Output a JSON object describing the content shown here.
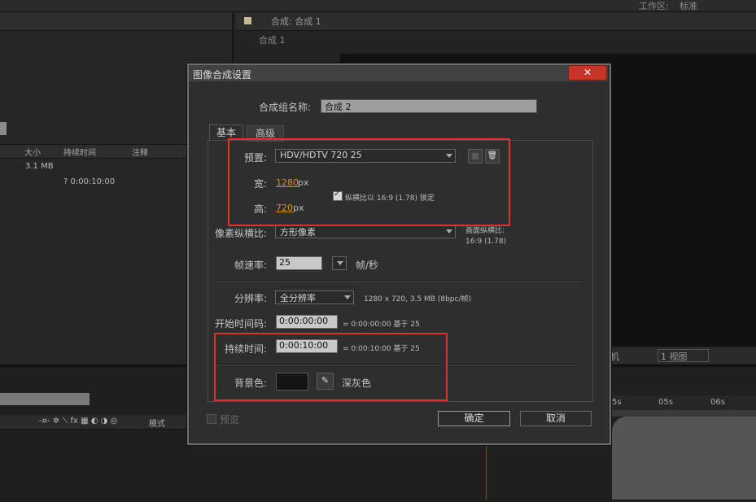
{
  "workspace": {
    "label": "工作区:",
    "value": "标准"
  },
  "project_panel": {
    "columns": [
      "大小",
      "持续时间",
      "注释"
    ],
    "rows": [
      {
        "size": "3.1 MB",
        "duration": ""
      },
      {
        "size": "",
        "duration": "? 0:00:10:00"
      }
    ]
  },
  "composition_panel": {
    "tab_label": "合成: 合成 1",
    "breadcrumb": "合成 1"
  },
  "viewer_toolbar": {
    "camera_suffix": "机",
    "view_select": "1 视图"
  },
  "timeline": {
    "ticks": [
      "5s",
      "05s",
      "06s"
    ],
    "mode_label": "模式"
  },
  "dialog": {
    "title": "图像合成设置",
    "close_label": "✕",
    "name_label": "合成组名称:",
    "name_value": "合成 2",
    "tabs": [
      "基本",
      "高级"
    ],
    "preset_label": "预置:",
    "preset_value": "HDV/HDTV 720 25",
    "width_label": "宽:",
    "width_value": "1280",
    "width_unit": "px",
    "height_label": "高:",
    "height_value": "720",
    "height_unit": "px",
    "lock_label": "纵横比以 16:9 (1.78) 锁定",
    "pixel_aspect_label": "像素纵横比:",
    "pixel_aspect_value": "方形像素",
    "frame_aspect_label": "画面纵横比:",
    "frame_aspect_value": "16:9 (1.78)",
    "frame_rate_label": "帧速率:",
    "frame_rate_value": "25",
    "frame_rate_unit": "帧/秒",
    "resolution_label": "分辨率:",
    "resolution_value": "全分辨率",
    "resolution_info": "1280 x 720, 3.5 MB (8bpc/帧)",
    "start_tc_label": "开始时间码:",
    "start_tc_value": "0:00:00:00",
    "start_tc_info": "= 0:00:00:00  基于 25",
    "duration_label": "持续时间:",
    "duration_value": "0:00:10:00",
    "duration_info": "= 0:00:10:00  基于 25",
    "bg_color_label": "背景色:",
    "bg_color_name": "深灰色",
    "preview_label": "预览",
    "ok_label": "确定",
    "cancel_label": "取消"
  },
  "colors": {
    "highlight_box": "#e2302f",
    "close_button": "#c7352a",
    "link_value": "#e08c1c"
  }
}
